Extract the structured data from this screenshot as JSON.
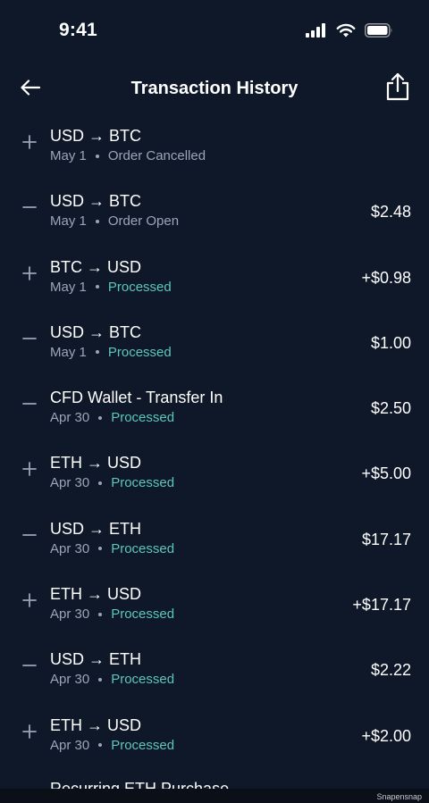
{
  "status_bar": {
    "time": "9:41"
  },
  "header": {
    "title": "Transaction History"
  },
  "transactions": [
    {
      "sign": "plus",
      "title": "USD → BTC",
      "date": "May 1",
      "status": "Order Cancelled",
      "status_kind": "neutral",
      "amount": ""
    },
    {
      "sign": "minus",
      "title": "USD → BTC",
      "date": "May 1",
      "status": "Order Open",
      "status_kind": "neutral",
      "amount": "$2.48"
    },
    {
      "sign": "plus",
      "title": "BTC → USD",
      "date": "May 1",
      "status": "Processed",
      "status_kind": "processed",
      "amount": "+$0.98"
    },
    {
      "sign": "minus",
      "title": "USD → BTC",
      "date": "May 1",
      "status": "Processed",
      "status_kind": "processed",
      "amount": "$1.00"
    },
    {
      "sign": "minus",
      "title": "CFD Wallet - Transfer In",
      "date": "Apr 30",
      "status": "Processed",
      "status_kind": "processed",
      "amount": "$2.50"
    },
    {
      "sign": "plus",
      "title": "ETH → USD",
      "date": "Apr 30",
      "status": "Processed",
      "status_kind": "processed",
      "amount": "+$5.00"
    },
    {
      "sign": "minus",
      "title": "USD → ETH",
      "date": "Apr 30",
      "status": "Processed",
      "status_kind": "processed",
      "amount": "$17.17"
    },
    {
      "sign": "plus",
      "title": "ETH → USD",
      "date": "Apr 30",
      "status": "Processed",
      "status_kind": "processed",
      "amount": "+$17.17"
    },
    {
      "sign": "minus",
      "title": "USD → ETH",
      "date": "Apr 30",
      "status": "Processed",
      "status_kind": "processed",
      "amount": "$2.22"
    },
    {
      "sign": "plus",
      "title": "ETH → USD",
      "date": "Apr 30",
      "status": "Processed",
      "status_kind": "processed",
      "amount": "+$2.00"
    }
  ],
  "partial_row": {
    "title": "Recurring ETH Purchase"
  },
  "footer": {
    "watermark": "Snapensnap"
  },
  "icons": {
    "back": "arrow-left-icon",
    "share": "share-icon",
    "signal": "cellular-signal-icon",
    "wifi": "wifi-icon",
    "battery": "battery-icon"
  },
  "colors": {
    "background": "#0F1828",
    "text_primary": "#FFFFFF",
    "text_secondary": "#9AA6B8",
    "processed": "#5CC7BA"
  }
}
